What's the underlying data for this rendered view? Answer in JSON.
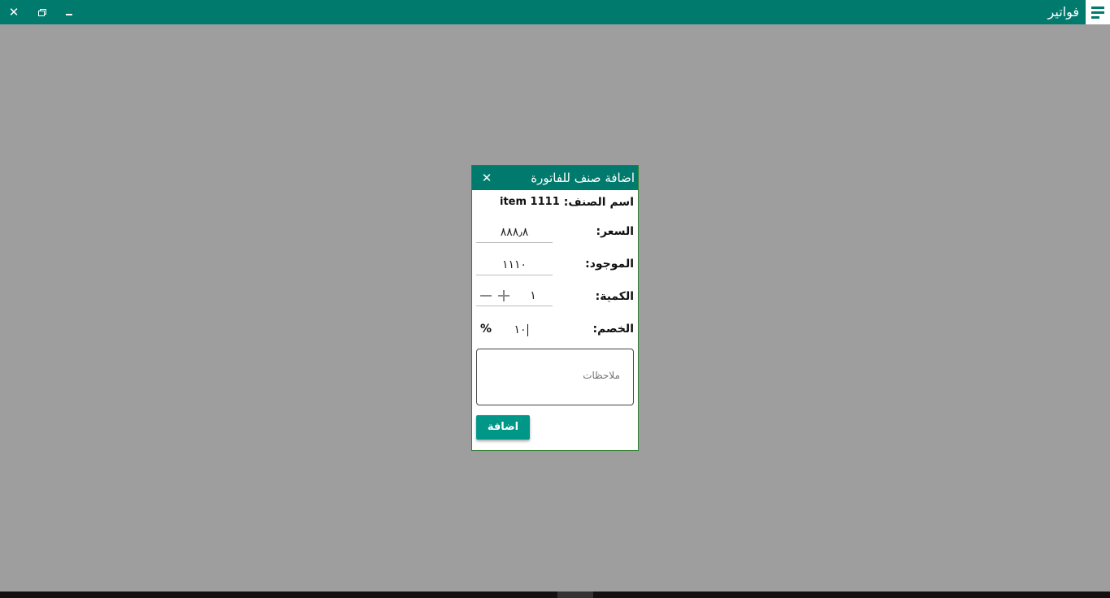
{
  "app": {
    "title": "فواتير",
    "close_icon": "✕"
  },
  "dialog": {
    "title": "اضافة صنف للفاتورة",
    "close_icon": "✕",
    "item_name_label": "اسم الصنف:",
    "item_name_value": "item 1111",
    "price_label": "السعر:",
    "price_value": "٨٨٨٫٨",
    "stock_label": "الموجود:",
    "stock_value": "١١١٠",
    "quantity_label": "الكمية:",
    "quantity_value": "١",
    "discount_label": "الخصم:",
    "discount_value": "١٠",
    "discount_unit": "%",
    "notes_placeholder": "ملاحظات",
    "add_button": "اضافة"
  },
  "colors": {
    "primary": "#017a6e",
    "accent": "#009688",
    "overlay": "#9e9e9e"
  }
}
